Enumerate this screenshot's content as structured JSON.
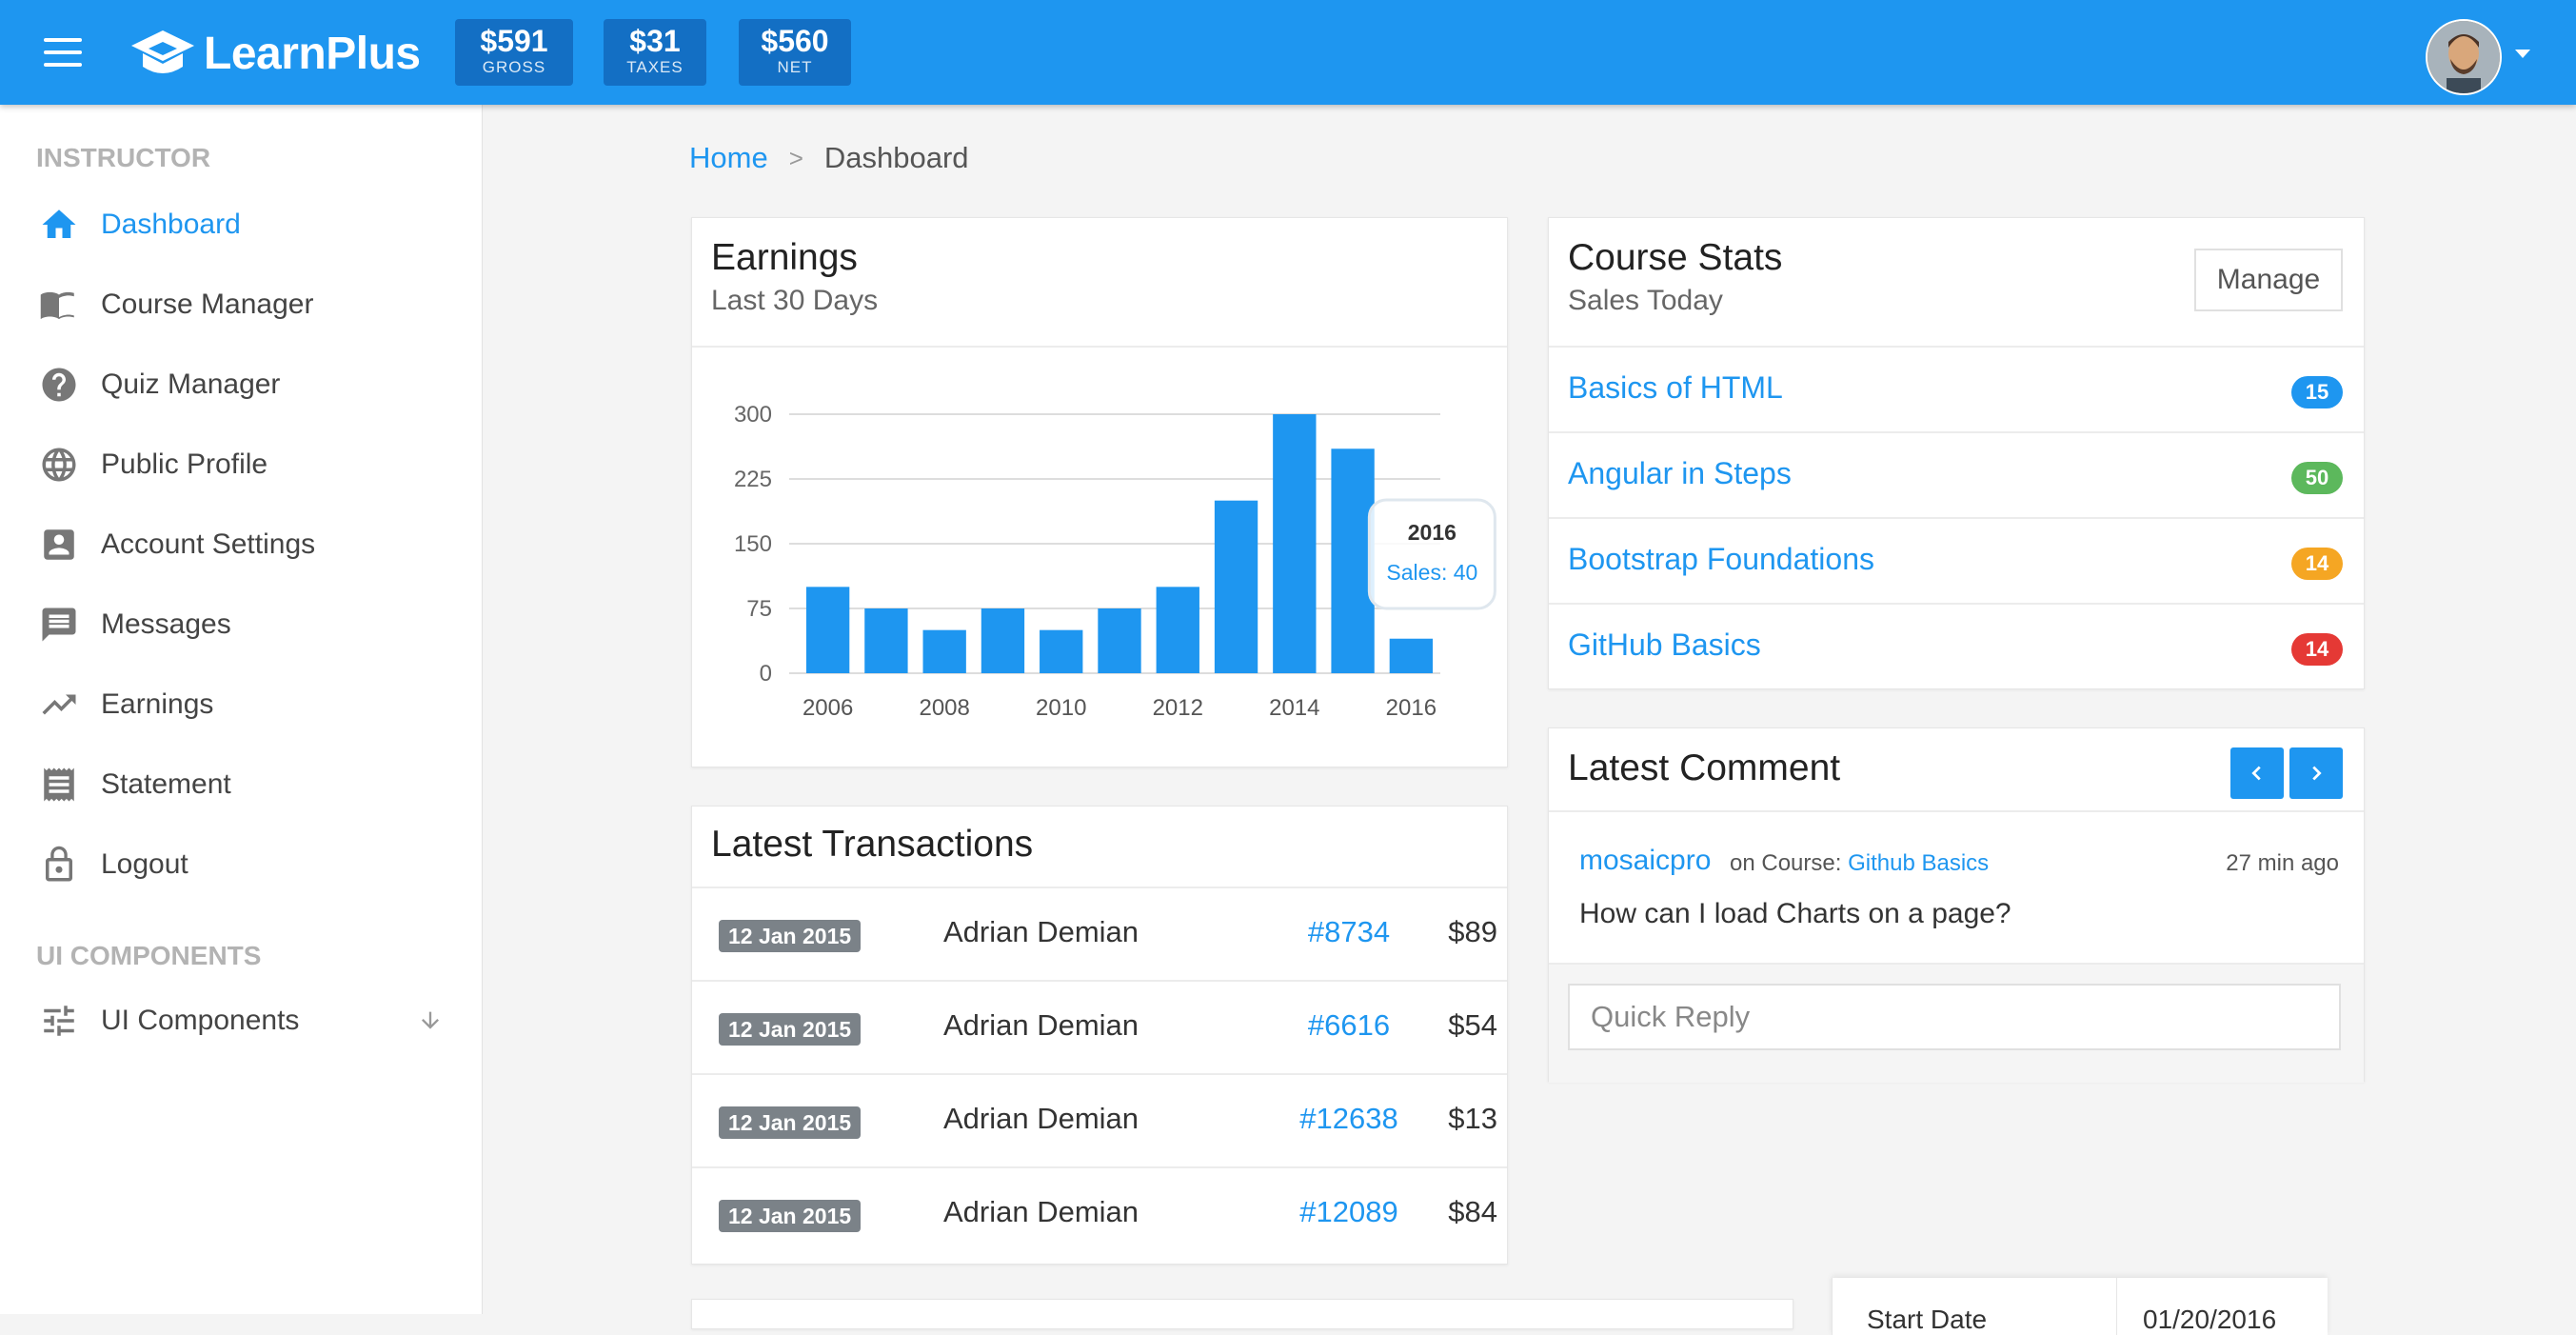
{
  "header": {
    "brand": "LearnPlus",
    "stats": [
      {
        "value": "$591",
        "label": "GROSS"
      },
      {
        "value": "$31",
        "label": "TAXES"
      },
      {
        "value": "$560",
        "label": "NET"
      }
    ]
  },
  "sidebar": {
    "section_instructor": "INSTRUCTOR",
    "items": [
      {
        "label": "Dashboard",
        "icon": "home-icon",
        "active": true
      },
      {
        "label": "Course Manager",
        "icon": "book-icon"
      },
      {
        "label": "Quiz Manager",
        "icon": "help-circle-icon"
      },
      {
        "label": "Public Profile",
        "icon": "globe-icon"
      },
      {
        "label": "Account Settings",
        "icon": "account-box-icon"
      },
      {
        "label": "Messages",
        "icon": "message-icon"
      },
      {
        "label": "Earnings",
        "icon": "trending-up-icon"
      },
      {
        "label": "Statement",
        "icon": "receipt-icon"
      },
      {
        "label": "Logout",
        "icon": "lock-icon"
      }
    ],
    "section_ui": "UI COMPONENTS",
    "ui_item": {
      "label": "UI Components",
      "icon": "tune-icon"
    }
  },
  "breadcrumb": {
    "home": "Home",
    "separator": ">",
    "current": "Dashboard"
  },
  "earnings": {
    "title": "Earnings",
    "subtitle": "Last 30 Days",
    "tooltip": {
      "year": "2016",
      "label": "Sales: 40"
    }
  },
  "chart_data": {
    "type": "bar",
    "categories": [
      "2006",
      "2007",
      "2008",
      "2009",
      "2010",
      "2011",
      "2012",
      "2013",
      "2014",
      "2015",
      "2016"
    ],
    "x_tick_labels": [
      "2006",
      "2008",
      "2010",
      "2012",
      "2014",
      "2016"
    ],
    "values": [
      100,
      75,
      50,
      75,
      50,
      75,
      100,
      200,
      300,
      260,
      40
    ],
    "y_ticks": [
      "300",
      "225",
      "150",
      "75",
      "0"
    ],
    "ylim": [
      0,
      300
    ],
    "bar_color": "#1e96f0",
    "grid": true,
    "title": "Earnings",
    "xlabel": "",
    "ylabel": ""
  },
  "transactions": {
    "title": "Latest Transactions",
    "rows": [
      {
        "date": "12 Jan 2015",
        "name": "Adrian Demian",
        "id": "#8734",
        "amount": "$89"
      },
      {
        "date": "12 Jan 2015",
        "name": "Adrian Demian",
        "id": "#6616",
        "amount": "$54"
      },
      {
        "date": "12 Jan 2015",
        "name": "Adrian Demian",
        "id": "#12638",
        "amount": "$13"
      },
      {
        "date": "12 Jan 2015",
        "name": "Adrian Demian",
        "id": "#12089",
        "amount": "$84"
      }
    ]
  },
  "course_stats": {
    "title": "Course Stats",
    "subtitle": "Sales Today",
    "manage_label": "Manage",
    "courses": [
      {
        "name": "Basics of HTML",
        "count": "15",
        "color": "#1e96f0"
      },
      {
        "name": "Angular in Steps",
        "count": "50",
        "color": "#5cb85c"
      },
      {
        "name": "Bootstrap Foundations",
        "count": "14",
        "color": "#f5a623"
      },
      {
        "name": "GitHub Basics",
        "count": "14",
        "color": "#e53935"
      }
    ]
  },
  "latest_comment": {
    "title": "Latest Comment",
    "user": "mosaicpro",
    "on_course_text": "on Course:",
    "course": "Github Basics",
    "time": "27 min ago",
    "text": "How can I load Charts on a page?",
    "reply_placeholder": "Quick Reply"
  },
  "partial_bottom": {
    "label": "Start Date",
    "value": "01/20/2016"
  },
  "colors": {
    "primary": "#1e96f0",
    "header_stat_bg": "#136fc4",
    "sidebar_header": "#b3b3b3"
  }
}
